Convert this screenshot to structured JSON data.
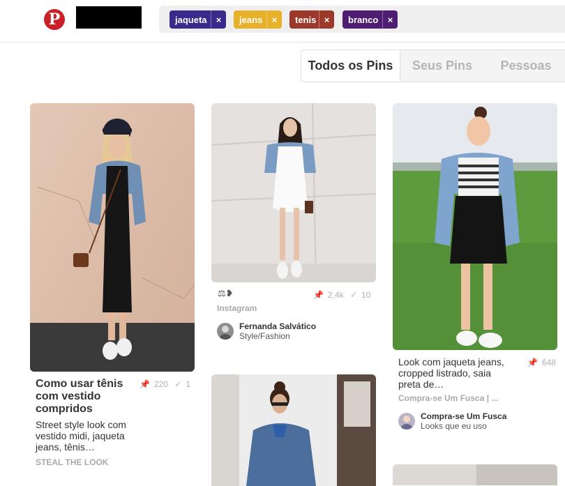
{
  "header": {
    "logo_letter": "P",
    "chips": [
      {
        "label": "jaqueta",
        "color": "#3a2a8c"
      },
      {
        "label": "jeans",
        "color": "#e8b12a"
      },
      {
        "label": "tenis",
        "color": "#9b3a2b"
      },
      {
        "label": "branco",
        "color": "#4f1e73"
      }
    ],
    "chip_remove": "×"
  },
  "tabs": [
    "Todos os Pins",
    "Seus Pins",
    "Pessoas"
  ],
  "pins": {
    "p1": {
      "title": "Como usar tênis com vestido compridos",
      "desc": "Street style look com vestido midi, jaqueta jeans, tênis…",
      "source": "STEAL THE LOOK",
      "repins": "220",
      "likes": "1"
    },
    "p2": {
      "repins": "2,4k",
      "likes": "10",
      "source": "Instagram",
      "user": "Fernanda Salvático",
      "board": "Style/Fashion"
    },
    "p3": {
      "title": "Look com jaqueta jeans, cropped listrado, saia preta de…",
      "repins": "648",
      "source": "Compra-se Um Fusca | ...",
      "user": "Compra-se Um Fusca",
      "board": "Looks que eu uso"
    }
  },
  "icons": {
    "repin": "pin-icon",
    "like": "check-icon",
    "scale": "scale-icon"
  }
}
